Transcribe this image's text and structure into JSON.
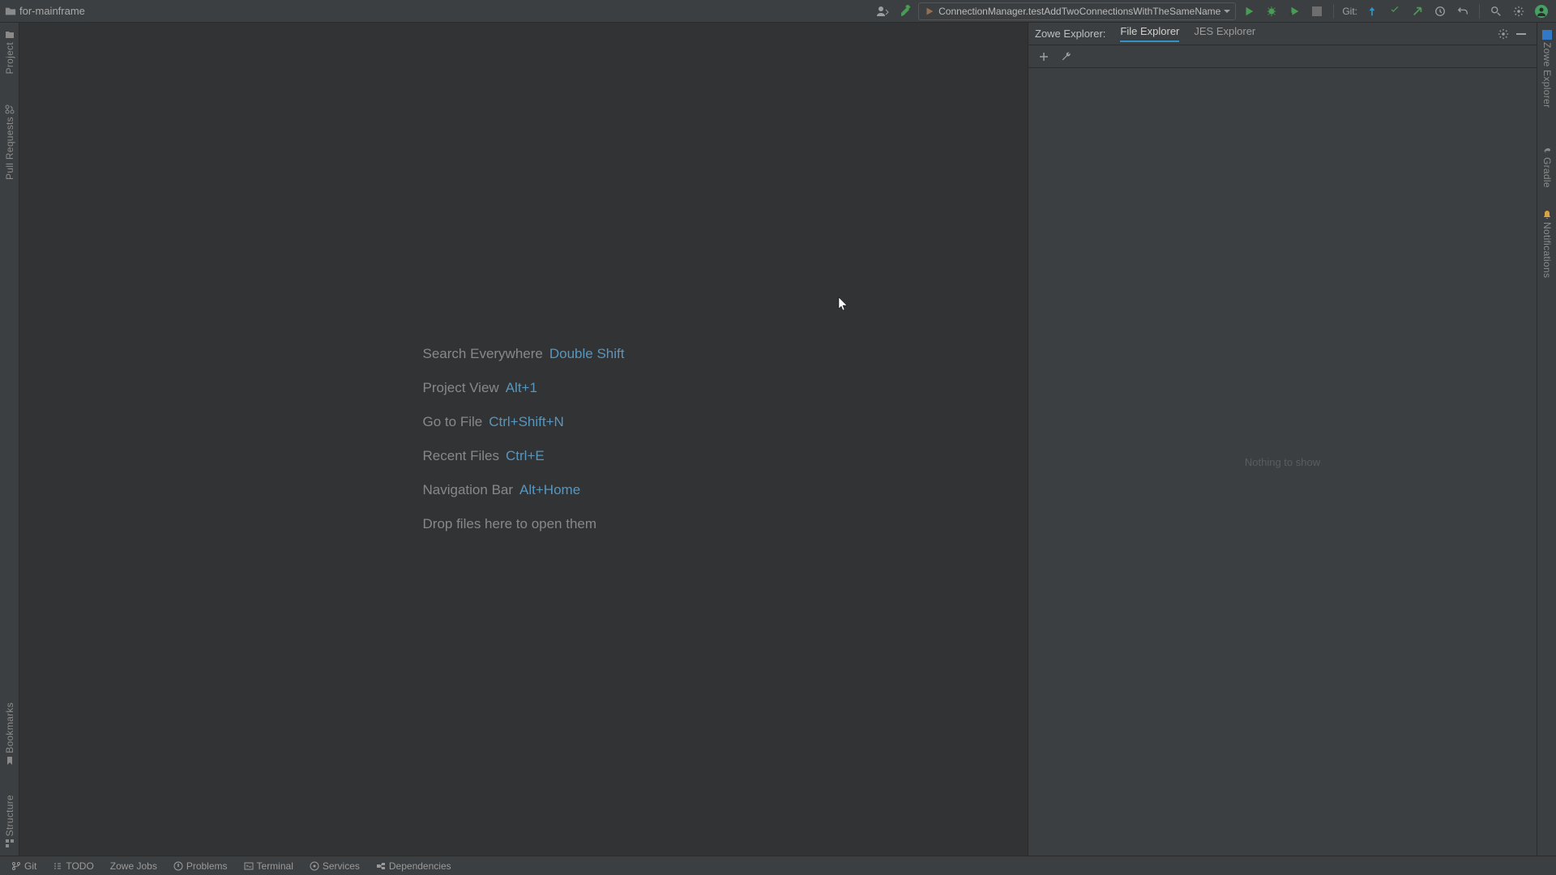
{
  "titlebar": {
    "project_name": "for-mainframe",
    "run_config_label": "ConnectionManager.testAddTwoConnectionsWithTheSameName",
    "git_label": "Git:"
  },
  "left_stripe": {
    "project": "Project",
    "pull_requests": "Pull Requests",
    "bookmarks": "Bookmarks",
    "structure": "Structure"
  },
  "right_stripe": {
    "zowe": "Zowe Explorer",
    "gradle": "Gradle",
    "notifications": "Notifications"
  },
  "editor_void": {
    "items": [
      {
        "label": "Search Everywhere",
        "shortcut": "Double Shift"
      },
      {
        "label": "Project View",
        "shortcut": "Alt+1"
      },
      {
        "label": "Go to File",
        "shortcut": "Ctrl+Shift+N"
      },
      {
        "label": "Recent Files",
        "shortcut": "Ctrl+E"
      },
      {
        "label": "Navigation Bar",
        "shortcut": "Alt+Home"
      }
    ],
    "drop_hint": "Drop files here to open them"
  },
  "side_panel": {
    "title": "Zowe Explorer:",
    "tabs": [
      "File Explorer",
      "JES Explorer"
    ],
    "active_tab": "File Explorer",
    "empty_text": "Nothing to show"
  },
  "bottom_bar": {
    "items": [
      "Git",
      "TODO",
      "Zowe Jobs",
      "Problems",
      "Terminal",
      "Services",
      "Dependencies"
    ]
  }
}
